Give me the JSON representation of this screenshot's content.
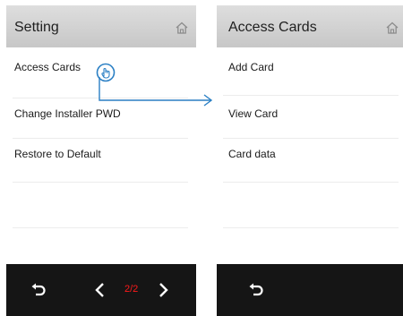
{
  "left_screen": {
    "title": "Setting",
    "items": [
      {
        "label": "Access Cards"
      },
      {
        "label": "Change Installer PWD"
      },
      {
        "label": "Restore to Default"
      }
    ],
    "page_indicator": "2/2"
  },
  "right_screen": {
    "title": "Access Cards",
    "items": [
      {
        "label": "Add Card"
      },
      {
        "label": "View Card"
      },
      {
        "label": "Card data"
      }
    ]
  },
  "icons": {
    "home": "home-icon",
    "back": "back-arrow-icon",
    "prev": "chevron-left-icon",
    "next": "chevron-right-icon",
    "tap": "tap-hand-icon"
  },
  "colors": {
    "titlebar": "#cfcfcf",
    "bottombar": "#151515",
    "page_indicator": "#ff1a1a",
    "connector": "#2a7fc4"
  }
}
